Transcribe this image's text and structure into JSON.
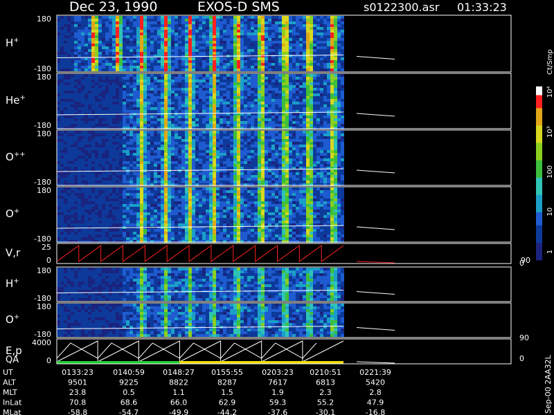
{
  "header": {
    "date": "Dec 23, 1990",
    "mission": "EXOS-D SMS",
    "file": "s0122300.asr",
    "time": "01:33:23"
  },
  "colorbar": {
    "label": "Ct/Smp",
    "ticks": [
      "1",
      "10",
      "100",
      "10³",
      "10⁴"
    ]
  },
  "side_labels": {
    "vr_right_top": "90",
    "vr_right_bottom": "0",
    "ep_right_top": "90",
    "ep_right_bottom": "0",
    "footer_id": "Sep-00  2AA32L"
  },
  "chart_data": [
    {
      "type": "heatmap",
      "label": "H",
      "sup": "+",
      "ymax": "180",
      "ymin": "-180",
      "data_extent_ut": "0210:51",
      "peak_level": "high"
    },
    {
      "type": "heatmap",
      "label": "He",
      "sup": "+",
      "ymax": "180",
      "ymin": "-180",
      "data_extent_ut": "0210:51",
      "peak_level": "medium"
    },
    {
      "type": "heatmap",
      "label": "O",
      "sup": "++",
      "ymax": "180",
      "ymin": "-180",
      "data_extent_ut": "0210:51",
      "peak_level": "medium"
    },
    {
      "type": "heatmap",
      "label": "O",
      "sup": "+",
      "ymax": "180",
      "ymin": "-180",
      "data_extent_ut": "0210:51",
      "peak_level": "medium"
    },
    {
      "type": "line",
      "label": "V,r",
      "ymax": "25",
      "ymin": "0",
      "right_range": [
        "0",
        "90"
      ],
      "series_color": "#ff2020",
      "cycles": 13
    },
    {
      "type": "heatmap",
      "label": "H",
      "sup": "+",
      "ymax": "180",
      "ymin": "-180",
      "data_extent_ut": "0210:51",
      "peak_level": "low"
    },
    {
      "type": "heatmap",
      "label": "O",
      "sup": "+",
      "ymax": "180",
      "ymin": "-180",
      "data_extent_ut": "0210:51",
      "peak_level": "low"
    },
    {
      "type": "line",
      "label": "E,p",
      "label2": "QA",
      "ymax": "4000",
      "ymin": "0",
      "right_range": [
        "0",
        "90"
      ],
      "series_color": "#ffffff",
      "cycles": 7,
      "qa_bar": [
        {
          "from": "0133:23",
          "to": "0148:27",
          "color": "#22cc33"
        },
        {
          "from": "0148:27",
          "to": "0210:51",
          "color": "#eedd00"
        }
      ]
    }
  ],
  "table": {
    "rows": [
      {
        "name": "UT",
        "values": [
          "0133:23",
          "0140:59",
          "0148:27",
          "0155:55",
          "0203:23",
          "0210:51",
          "0221:39"
        ]
      },
      {
        "name": "ALT",
        "values": [
          "9501",
          "9225",
          "8822",
          "8287",
          "7617",
          "6813",
          "5420"
        ]
      },
      {
        "name": "MLT",
        "values": [
          "23.8",
          "0.5",
          "1.1",
          "1.5",
          "1.9",
          "2.3",
          "2.8"
        ]
      },
      {
        "name": "InLat",
        "values": [
          "70.8",
          "68.6",
          "66.0",
          "62.9",
          "59.3",
          "55.2",
          "47.9"
        ]
      },
      {
        "name": "MLat",
        "values": [
          "-58.8",
          "-54.7",
          "-49.9",
          "-44.2",
          "-37.6",
          "-30.1",
          "-16.8"
        ]
      }
    ]
  }
}
